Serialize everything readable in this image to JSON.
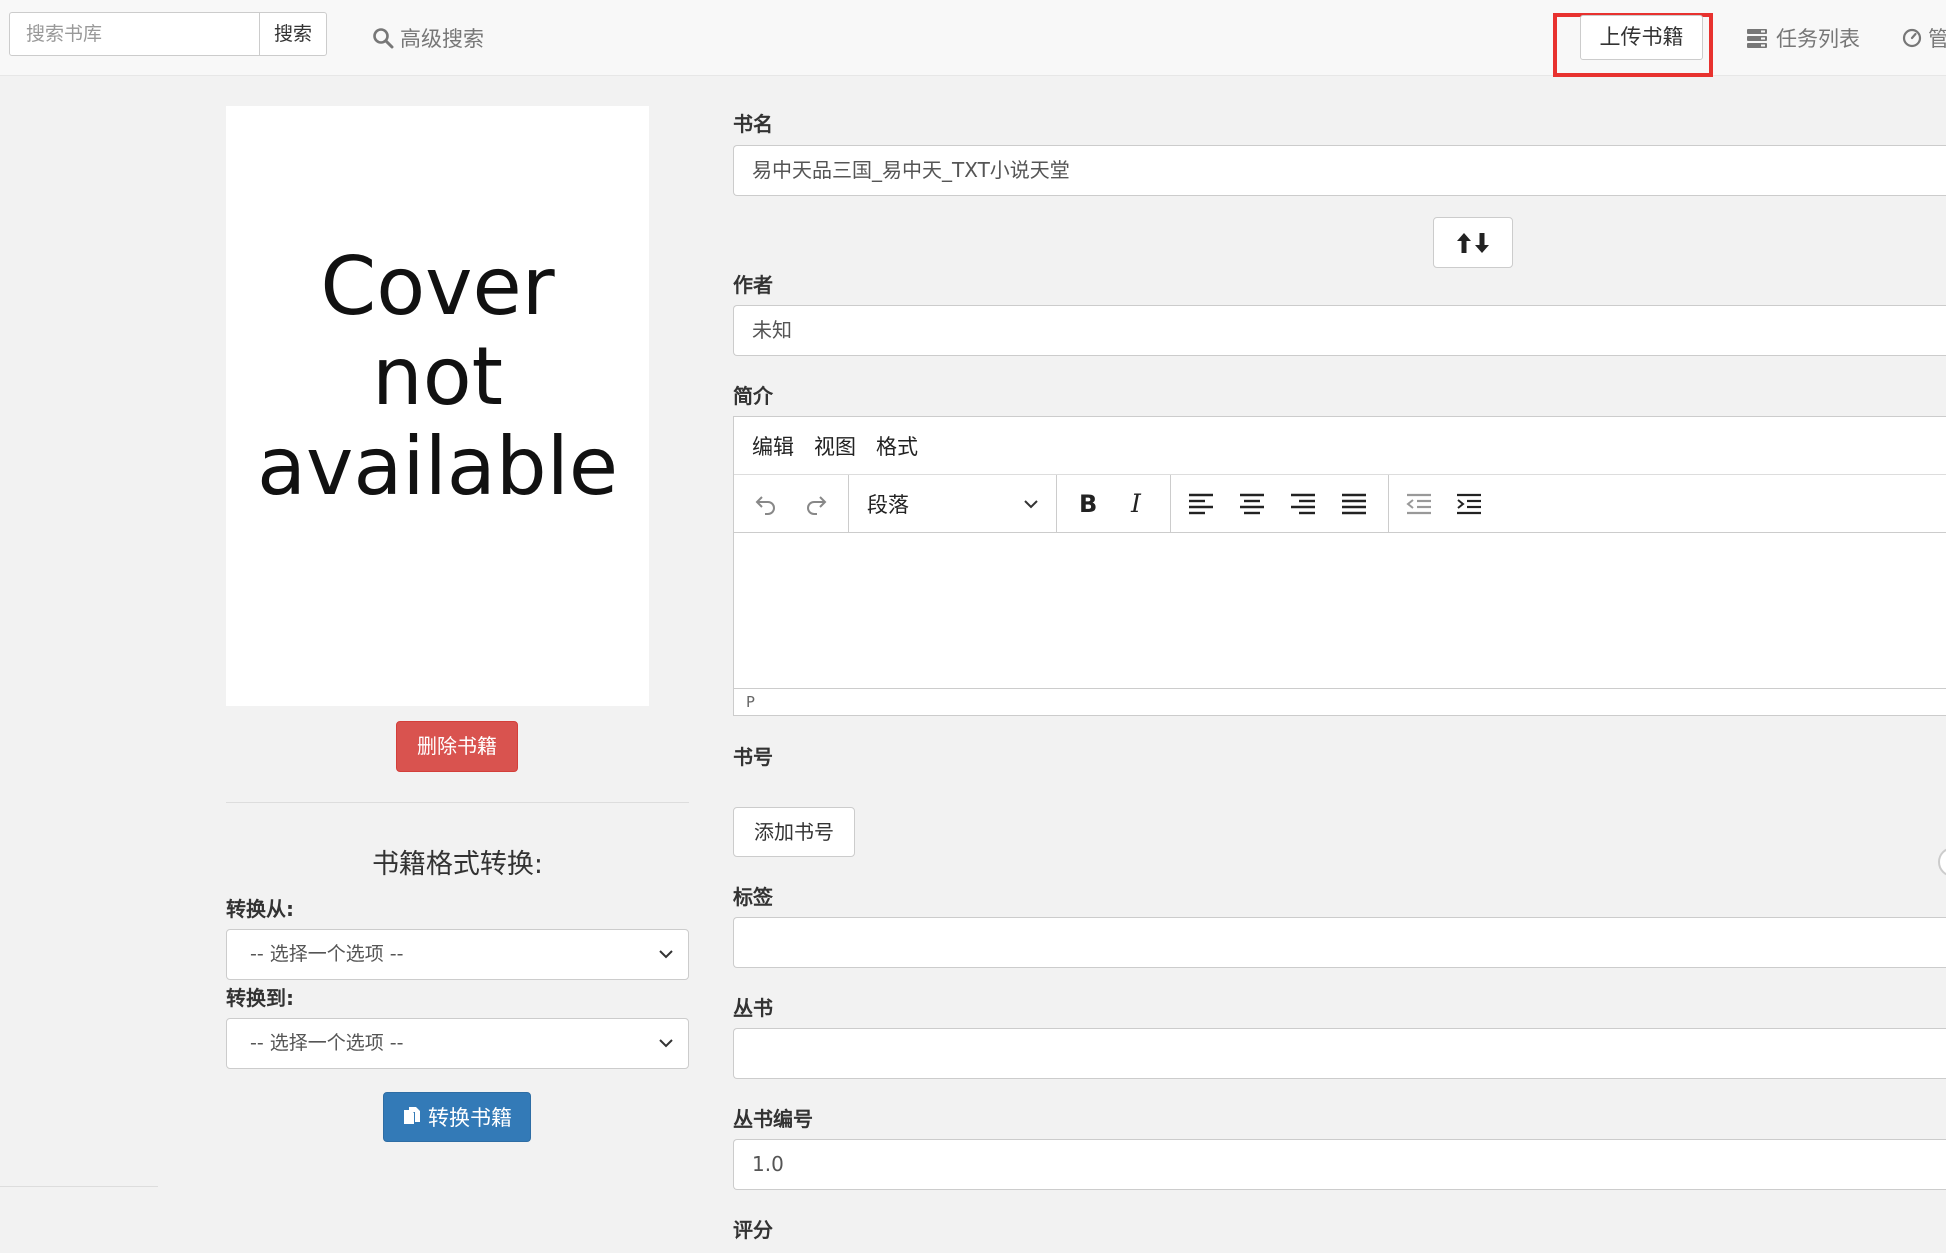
{
  "navbar": {
    "search_placeholder": "搜索书库",
    "search_button": "搜索",
    "advanced_search": "高级搜索",
    "upload_button": "上传书籍",
    "task_list": "任务列表",
    "admin": "管"
  },
  "cover": {
    "text": "Cover\nnot\navailable"
  },
  "left": {
    "delete_button": "删除书籍",
    "convert_heading": "书籍格式转换:",
    "convert_from_label": "转换从:",
    "convert_from_value": "-- 选择一个选项 --",
    "convert_to_label": "转换到:",
    "convert_to_value": "-- 选择一个选项 --",
    "convert_button": "转换书籍"
  },
  "form": {
    "title_label": "书名",
    "title_value": "易中天品三国_易中天_TXT小说天堂",
    "author_label": "作者",
    "author_value": "未知",
    "description_label": "简介",
    "editor": {
      "menu": [
        "编辑",
        "视图",
        "格式"
      ],
      "block_format": "段落",
      "status_path": "P"
    },
    "isbn_label": "书号",
    "add_isbn_button": "添加书号",
    "tags_label": "标签",
    "tags_value": "",
    "series_label": "丛书",
    "series_value": "",
    "series_index_label": "丛书编号",
    "series_index_value": "1.0",
    "rating_label": "评分"
  },
  "colors": {
    "highlight": "#e8322f",
    "danger": "#d9534f",
    "primary": "#337ab7"
  }
}
